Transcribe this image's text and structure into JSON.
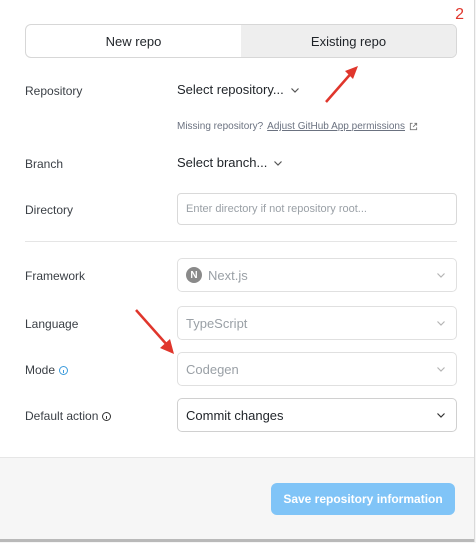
{
  "page_number": "2",
  "tabs": [
    {
      "label": "New repo"
    },
    {
      "label": "Existing repo"
    }
  ],
  "repository": {
    "label": "Repository",
    "value": "Select repository...",
    "hint_prefix": "Missing repository?",
    "hint_link": "Adjust GitHub App permissions"
  },
  "branch": {
    "label": "Branch",
    "value": "Select branch..."
  },
  "directory": {
    "label": "Directory",
    "placeholder": "Enter directory if not repository root..."
  },
  "framework": {
    "label": "Framework",
    "value": "Next.js",
    "logo_letter": "N"
  },
  "language": {
    "label": "Language",
    "value": "TypeScript"
  },
  "mode": {
    "label": "Mode",
    "value": "Codegen"
  },
  "default_action": {
    "label": "Default action",
    "value": "Commit changes"
  },
  "footer": {
    "save_label": "Save repository information"
  },
  "colors": {
    "accent": "#80c4f7",
    "annotation": "#e0362c",
    "info_icon": "#3b9bdc"
  }
}
